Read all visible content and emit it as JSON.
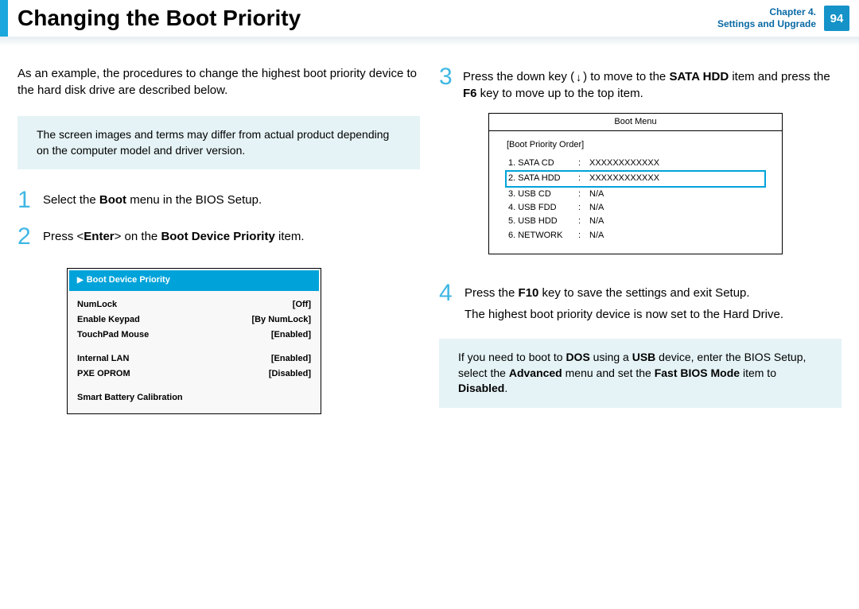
{
  "header": {
    "title": "Changing the Boot Priority",
    "chapter_line1": "Chapter 4.",
    "chapter_line2": "Settings and Upgrade",
    "page_number": "94"
  },
  "left": {
    "intro": "As an example, the procedures to change the highest boot priority device to the hard disk drive are described below.",
    "note": "The screen images and terms may differ from actual product depending on the computer model and driver version.",
    "step1_num": "1",
    "step1_a": "Select the ",
    "step1_b": "Boot",
    "step1_c": " menu in the BIOS Setup.",
    "step2_num": "2",
    "step2_a": "Press <",
    "step2_b": "Enter",
    "step2_c": "> on the ",
    "step2_d": "Boot Device Priority",
    "step2_e": " item.",
    "bios": {
      "header": "Boot Device Priority",
      "rows1": [
        {
          "k": "NumLock",
          "v": "[Off]"
        },
        {
          "k": "Enable Keypad",
          "v": "[By NumLock]"
        },
        {
          "k": "TouchPad Mouse",
          "v": "[Enabled]"
        }
      ],
      "rows2": [
        {
          "k": "Internal LAN",
          "v": "[Enabled]"
        },
        {
          "k": "PXE OPROM",
          "v": "[Disabled]"
        }
      ],
      "footer": "Smart Battery Calibration"
    }
  },
  "right": {
    "step3_num": "3",
    "step3_a": "Press the down key (",
    "step3_arrow": "↓",
    "step3_b": ") to move to the ",
    "step3_c": "SATA HDD",
    "step3_d": " item and press the ",
    "step3_e": "F6",
    "step3_f": " key to move up to the top item.",
    "boot_menu": {
      "title": "Boot Menu",
      "section": "[Boot Priority Order]",
      "items": [
        {
          "n": "1. SATA CD",
          "v": "XXXXXXXXXXXX"
        },
        {
          "n": "2. SATA HDD",
          "v": "XXXXXXXXXXXX",
          "hl": true
        },
        {
          "n": "3. USB CD",
          "v": "N/A"
        },
        {
          "n": "4. USB FDD",
          "v": "N/A"
        },
        {
          "n": "5. USB HDD",
          "v": "N/A"
        },
        {
          "n": "6. NETWORK",
          "v": "N/A"
        }
      ]
    },
    "step4_num": "4",
    "step4_a": "Press the ",
    "step4_b": "F10",
    "step4_c": " key to save the settings and exit Setup.",
    "step4_line2": "The highest boot priority device is now set to the Hard Drive.",
    "note2_a": "If you need to boot to ",
    "note2_b": "DOS",
    "note2_c": " using a ",
    "note2_d": "USB",
    "note2_e": " device, enter the BIOS Setup, select the ",
    "note2_f": "Advanced",
    "note2_g": " menu and set the ",
    "note2_h": "Fast BIOS Mode",
    "note2_i": " item to ",
    "note2_j": "Disabled",
    "note2_k": "."
  }
}
